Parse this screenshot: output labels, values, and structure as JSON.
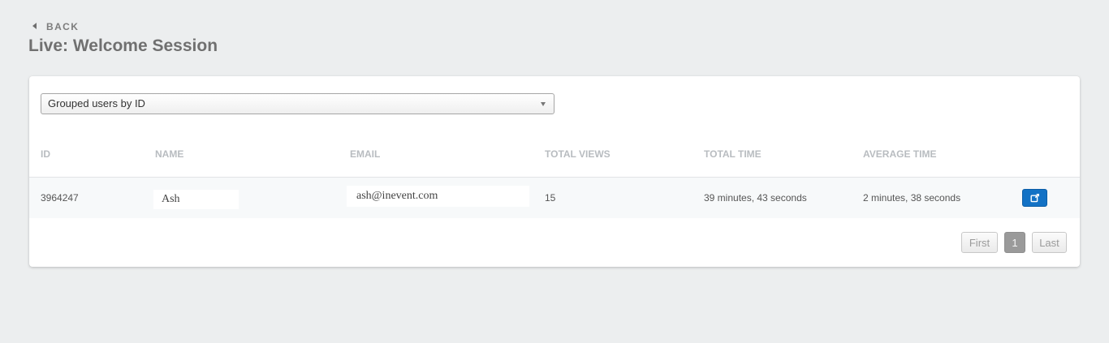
{
  "header": {
    "back_label": "BACK",
    "title": "Live: Welcome Session"
  },
  "filter": {
    "selected": "Grouped users by ID"
  },
  "table": {
    "columns": [
      "ID",
      "NAME",
      "EMAIL",
      "TOTAL VIEWS",
      "TOTAL TIME",
      "AVERAGE TIME"
    ],
    "rows": [
      {
        "id": "3964247",
        "name": "Ash",
        "email": "ash@inevent.com",
        "total_views": "15",
        "total_time": "39 minutes, 43 seconds",
        "average_time": "2 minutes, 38 seconds"
      }
    ]
  },
  "pagination": {
    "first_label": "First",
    "current_page": "1",
    "last_label": "Last"
  },
  "icons": {
    "back": "caret-left-icon",
    "open": "external-link-icon",
    "dropdown": "chevron-down-icon"
  },
  "colors": {
    "background": "#eceeef",
    "accent": "#1372c5",
    "active_page": "#9a9a9a"
  }
}
